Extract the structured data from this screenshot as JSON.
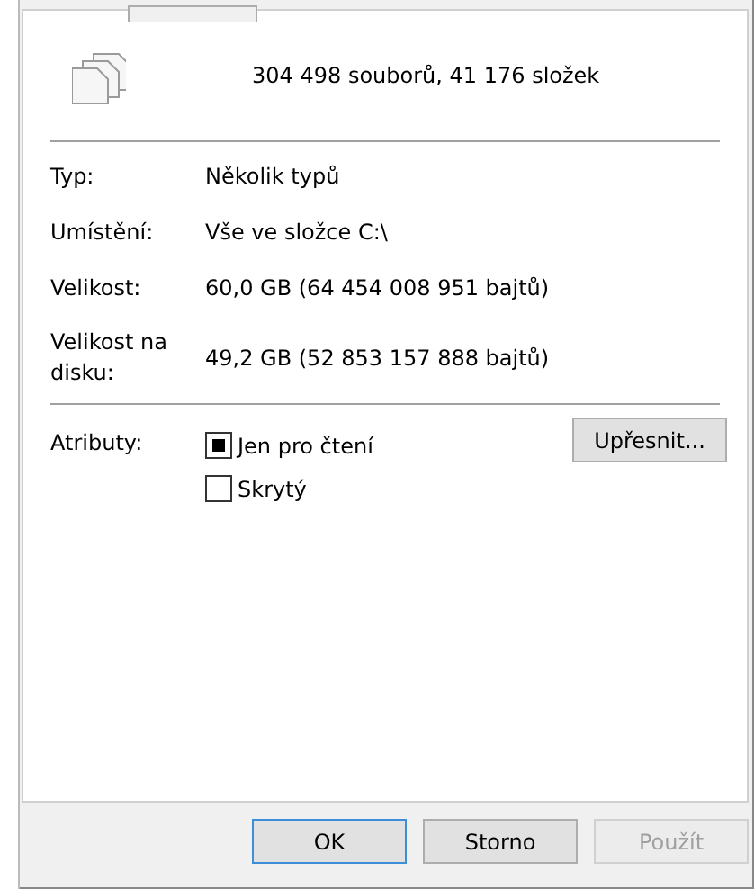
{
  "summary": "304 498 souborů, 41 176 složek",
  "properties": [
    {
      "label": "Typ:",
      "value": "Několik typů"
    },
    {
      "label": "Umístění:",
      "value": "Vše ve složce C:\\"
    },
    {
      "label": "Velikost:",
      "value": "60,0 GB (64 454 008 951 bajtů)"
    },
    {
      "label": "Velikost na disku:",
      "value": "49,2 GB (52 853 157 888 bajtů)"
    }
  ],
  "attributes": {
    "label": "Atributy:",
    "options": [
      {
        "label": "Jen pro čtení",
        "checked": false,
        "indeterminate": true
      },
      {
        "label": "Skrytý",
        "checked": false,
        "indeterminate": false
      }
    ],
    "advanced_button": "Upřesnit..."
  },
  "buttons": [
    {
      "label": "OK",
      "default": true,
      "disabled": false
    },
    {
      "label": "Storno",
      "default": false,
      "disabled": false
    },
    {
      "label": "Použít",
      "default": false,
      "disabled": true
    }
  ]
}
